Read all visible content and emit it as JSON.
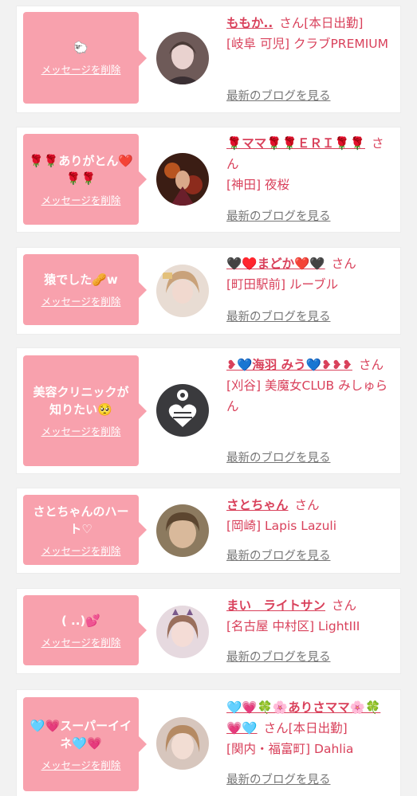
{
  "delete_label": "メッセージを削除",
  "san_label": "さん",
  "blog_label": "最新のブログを見る",
  "colors": {
    "bubble": "#f8a1ad",
    "accent": "#d9415b",
    "muted": "#777777",
    "background": "#f2f2f2"
  },
  "cards": [
    {
      "message": "🐑",
      "name": "ももか..",
      "status": "[本日出勤]",
      "shop": "[岐阜 可児] クラブPREMIUM",
      "avatar_icon": "profile-photo"
    },
    {
      "message": "🌹🌹ありがとん❤️🌹🌹",
      "name": "🌹ママ🌹🌹ＥＲＩ🌹🌹",
      "status": "",
      "shop": "[神田] 夜桜",
      "avatar_icon": "profile-photo"
    },
    {
      "message": "猿でした🥜w",
      "name": "🖤♥️まどか❤️🖤",
      "status": "",
      "shop": "[町田駅前] ルーブル",
      "avatar_icon": "profile-photo"
    },
    {
      "message": "美容クリニックが知りたい🥺",
      "name": "❥💙海羽 みう💙❥❥❥",
      "status": "",
      "shop": "[刈谷] 美魔女CLUB みしゅらん",
      "avatar_icon": "profile-photo"
    },
    {
      "message": "さとちゃんのハート♡",
      "name": "さとちゃん",
      "status": "",
      "shop": "[岡崎] Lapis Lazuli",
      "avatar_icon": "profile-photo"
    },
    {
      "message": "( ..)💕",
      "name": "まい　ライトサン",
      "status": "",
      "shop": "[名古屋 中村区] LightIII",
      "avatar_icon": "profile-photo"
    },
    {
      "message": "🩵💗スーパーイイネ🩵💗",
      "name": "🩵💗🍀🌸ありさママ🌸🍀💗🩵",
      "status": "[本日出勤]",
      "shop": "[関内・福富町] Dahlia",
      "avatar_icon": "profile-photo"
    }
  ]
}
